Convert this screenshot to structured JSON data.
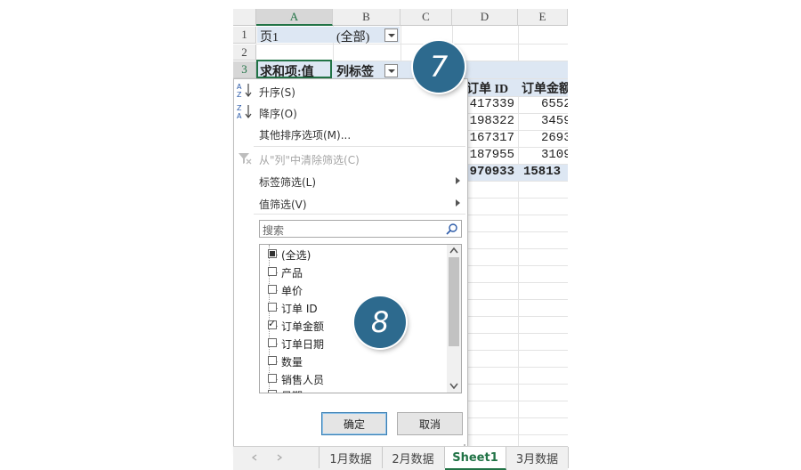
{
  "columns": [
    "A",
    "B",
    "C",
    "D",
    "E"
  ],
  "rows": [
    "1",
    "2",
    "3"
  ],
  "cells": {
    "a1": "页1",
    "b1": "(全部)",
    "a3": "求和项:值",
    "b3": "列标签",
    "d4": "订单 ID",
    "e4": "订单金额",
    "d_values": [
      "417339",
      "198322",
      "167317",
      "187955"
    ],
    "e_values": [
      "6552",
      "3459",
      "2693",
      "3109"
    ],
    "d_total": "970933",
    "e_total": "15813"
  },
  "menu": {
    "sort_asc": "升序(S)",
    "sort_desc": "降序(O)",
    "more_sort": "其他排序选项(M)...",
    "clear_filter": "从\"列\"中清除筛选(C)",
    "label_filter": "标签筛选(L)",
    "value_filter": "值筛选(V)",
    "search_placeholder": "搜索",
    "list": [
      {
        "label": "(全选)",
        "state": "partial"
      },
      {
        "label": "产品",
        "state": "unchecked"
      },
      {
        "label": "单价",
        "state": "unchecked"
      },
      {
        "label": "订单 ID",
        "state": "unchecked"
      },
      {
        "label": "订单金额",
        "state": "checked"
      },
      {
        "label": "订单日期",
        "state": "unchecked"
      },
      {
        "label": "数量",
        "state": "unchecked"
      },
      {
        "label": "销售人员",
        "state": "unchecked"
      },
      {
        "label": "日期",
        "state": "unchecked"
      }
    ],
    "ok": "确定",
    "cancel": "取消"
  },
  "badges": {
    "step7": "7",
    "step8": "8"
  },
  "tabs": [
    "1月数据",
    "2月数据",
    "Sheet1",
    "3月数据"
  ],
  "active_tab": "Sheet1",
  "colors": {
    "accent": "#217346",
    "badge": "#2d6a8e",
    "pivot_fill": "#dde7f3"
  }
}
